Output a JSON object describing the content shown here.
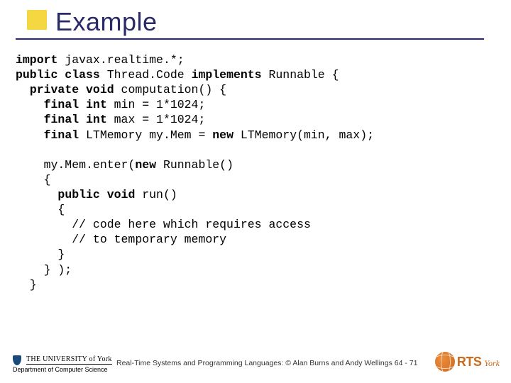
{
  "title": "Example",
  "code_lines": [
    [
      {
        "t": "import",
        "b": true
      },
      {
        "t": " javax.realtime.*;",
        "b": false
      }
    ],
    [
      {
        "t": "public class",
        "b": true
      },
      {
        "t": " Thread.Code ",
        "b": false
      },
      {
        "t": "implements",
        "b": true
      },
      {
        "t": " Runnable {",
        "b": false
      }
    ],
    [
      {
        "t": "  ",
        "b": false
      },
      {
        "t": "private void",
        "b": true
      },
      {
        "t": " computation() {",
        "b": false
      }
    ],
    [
      {
        "t": "    ",
        "b": false
      },
      {
        "t": "final int",
        "b": true
      },
      {
        "t": " min = 1*1024;",
        "b": false
      }
    ],
    [
      {
        "t": "    ",
        "b": false
      },
      {
        "t": "final int",
        "b": true
      },
      {
        "t": " max = 1*1024;",
        "b": false
      }
    ],
    [
      {
        "t": "    ",
        "b": false
      },
      {
        "t": "final",
        "b": true
      },
      {
        "t": " LTMemory my.Mem = ",
        "b": false
      },
      {
        "t": "new",
        "b": true
      },
      {
        "t": " LTMemory(min, max);",
        "b": false
      }
    ],
    [
      {
        "t": "",
        "b": false
      }
    ],
    [
      {
        "t": "    my.Mem.enter(",
        "b": false
      },
      {
        "t": "new",
        "b": true
      },
      {
        "t": " Runnable()",
        "b": false
      }
    ],
    [
      {
        "t": "    {",
        "b": false
      }
    ],
    [
      {
        "t": "      ",
        "b": false
      },
      {
        "t": "public void",
        "b": true
      },
      {
        "t": " run()",
        "b": false
      }
    ],
    [
      {
        "t": "      {",
        "b": false
      }
    ],
    [
      {
        "t": "        // code here which requires access",
        "b": false
      }
    ],
    [
      {
        "t": "        // to temporary memory",
        "b": false
      }
    ],
    [
      {
        "t": "      }",
        "b": false
      }
    ],
    [
      {
        "t": "    } );",
        "b": false
      }
    ],
    [
      {
        "t": "  }",
        "b": false
      }
    ]
  ],
  "footer": {
    "text": "Real-Time Systems and Programming Languages: © Alan Burns and Andy Wellings 64 - 71",
    "uni_top": "THE UNIVERSITY of York",
    "uni_bot": "Department of Computer Science",
    "rts": "RTS",
    "york": "York"
  }
}
